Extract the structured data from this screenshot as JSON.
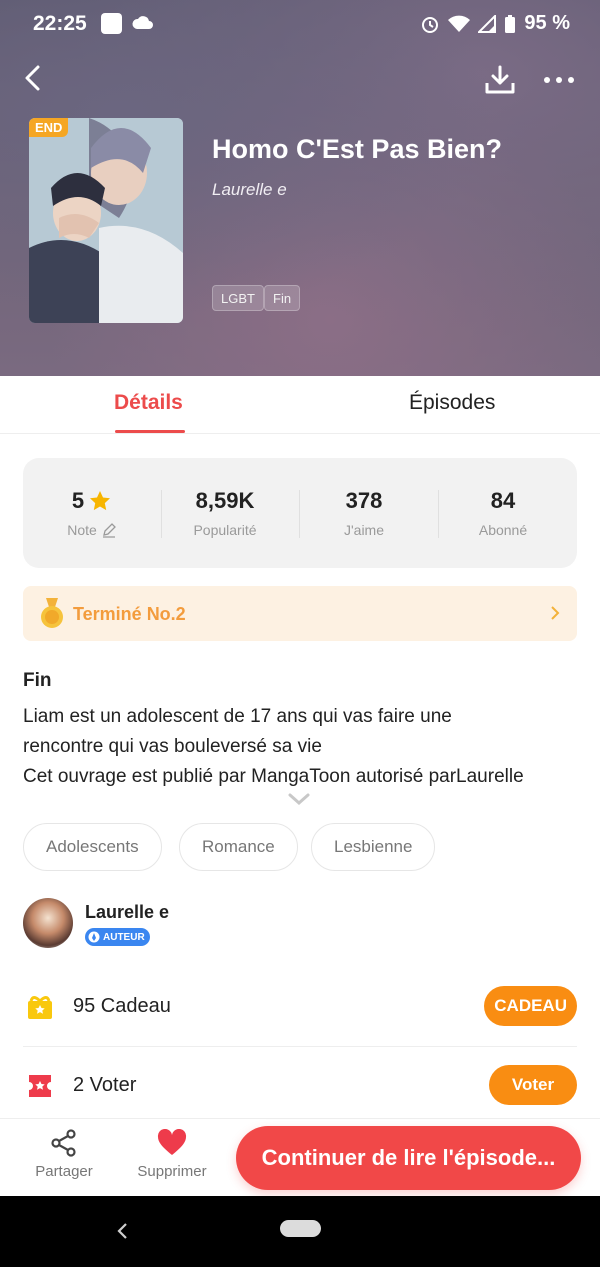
{
  "status": {
    "time": "22:25",
    "battery": "95 %"
  },
  "book": {
    "title": "Homo C'Est Pas Bien?",
    "author": "Laurelle e",
    "end_badge": "END",
    "genres": [
      "LGBT",
      "Fin"
    ]
  },
  "tabs": {
    "details": "Détails",
    "episodes": "Épisodes"
  },
  "stats": [
    {
      "value": "5",
      "label": "Note"
    },
    {
      "value": "8,59K",
      "label": "Popularité"
    },
    {
      "value": "378",
      "label": "J'aime"
    },
    {
      "value": "84",
      "label": "Abonné"
    }
  ],
  "ranking": {
    "label": "Terminé No.2"
  },
  "description": {
    "heading": "Fin",
    "lines": [
      "Liam est un adolescent de 17 ans qui vas faire une",
      "rencontre qui vas bouleversé sa vie",
      "Cet ouvrage est publié par MangaToon  autorisé parLaurelle"
    ]
  },
  "tags": [
    "Adolescents",
    "Romance",
    "Lesbienne"
  ],
  "author_card": {
    "name": "Laurelle e",
    "badge": "AUTEUR"
  },
  "gift": {
    "text": "95  Cadeau",
    "button": "CADEAU"
  },
  "vote": {
    "text": "2  Voter",
    "button": "Voter"
  },
  "bottom_bar": {
    "share": "Partager",
    "remove": "Supprimer",
    "continue": "Continuer de lire l'épisode..."
  },
  "colors": {
    "accent": "#ec4b4b",
    "orange": "#f98d12",
    "rank_text": "#f39c3d"
  }
}
